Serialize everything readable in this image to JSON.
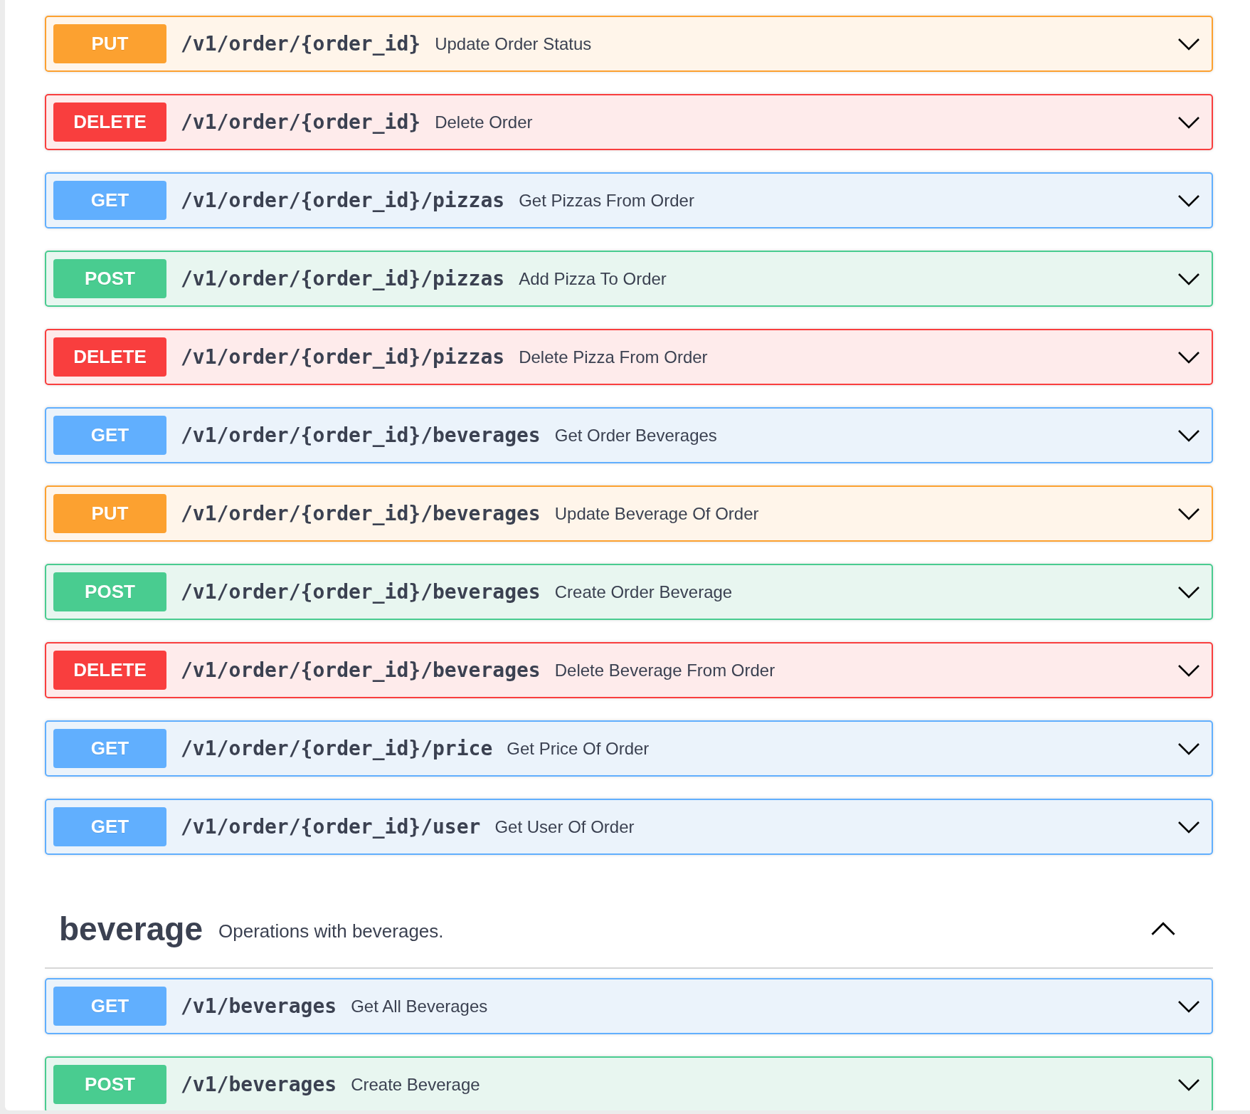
{
  "operations": [
    {
      "kind": "put",
      "method": "PUT",
      "path": "/v1/order/{order_id}",
      "summary": "Update Order Status",
      "expanded": false
    },
    {
      "kind": "delete",
      "method": "DELETE",
      "path": "/v1/order/{order_id}",
      "summary": "Delete Order",
      "expanded": false
    },
    {
      "kind": "get",
      "method": "GET",
      "path": "/v1/order/{order_id}/pizzas",
      "summary": "Get Pizzas From Order",
      "expanded": false
    },
    {
      "kind": "post",
      "method": "POST",
      "path": "/v1/order/{order_id}/pizzas",
      "summary": "Add Pizza To Order",
      "expanded": false
    },
    {
      "kind": "delete",
      "method": "DELETE",
      "path": "/v1/order/{order_id}/pizzas",
      "summary": "Delete Pizza From Order",
      "expanded": false
    },
    {
      "kind": "get",
      "method": "GET",
      "path": "/v1/order/{order_id}/beverages",
      "summary": "Get Order Beverages",
      "expanded": false
    },
    {
      "kind": "put",
      "method": "PUT",
      "path": "/v1/order/{order_id}/beverages",
      "summary": "Update Beverage Of Order",
      "expanded": false
    },
    {
      "kind": "post",
      "method": "POST",
      "path": "/v1/order/{order_id}/beverages",
      "summary": "Create Order Beverage",
      "expanded": false
    },
    {
      "kind": "delete",
      "method": "DELETE",
      "path": "/v1/order/{order_id}/beverages",
      "summary": "Delete Beverage From Order",
      "expanded": false
    },
    {
      "kind": "get",
      "method": "GET",
      "path": "/v1/order/{order_id}/price",
      "summary": "Get Price Of Order",
      "expanded": false
    },
    {
      "kind": "get",
      "method": "GET",
      "path": "/v1/order/{order_id}/user",
      "summary": "Get User Of Order",
      "expanded": false
    }
  ],
  "section": {
    "name": "beverage",
    "description": "Operations with beverages.",
    "expanded": true,
    "operations": [
      {
        "kind": "get",
        "method": "GET",
        "path": "/v1/beverages",
        "summary": "Get All Beverages",
        "expanded": false
      },
      {
        "kind": "post",
        "method": "POST",
        "path": "/v1/beverages",
        "summary": "Create Beverage",
        "expanded": false
      }
    ]
  }
}
